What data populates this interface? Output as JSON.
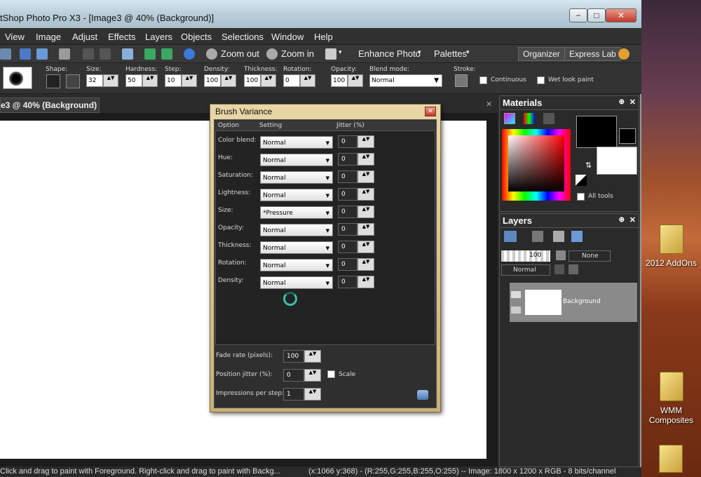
{
  "window": {
    "title": "tShop Photo Pro X3 - [Image3 @  40% (Background)]",
    "minimize": "−",
    "maximize": "□",
    "close": "✕"
  },
  "menu": [
    "View",
    "Image",
    "Adjust",
    "Effects",
    "Layers",
    "Objects",
    "Selections",
    "Window",
    "Help"
  ],
  "toolbar": {
    "zoom_out": "Zoom out",
    "zoom_in": "Zoom in",
    "enhance_photo": "Enhance Photo",
    "palettes": "Palettes",
    "organizer": "Organizer",
    "express_lab": "Express Lab",
    "arrow": "▾"
  },
  "tool_options": {
    "shape_label": "Shape:",
    "size_label": "Size:",
    "size_value": "32",
    "hardness_label": "Hardness:",
    "hardness_value": "50",
    "step_label": "Step:",
    "step_value": "10",
    "density_label": "Density:",
    "density_value": "100",
    "thickness_label": "Thickness:",
    "thickness_value": "100",
    "rotation_label": "Rotation:",
    "rotation_value": "0",
    "opacity_label": "Opacity:",
    "opacity_value": "100",
    "blend_mode_label": "Blend mode:",
    "blend_mode_value": "Normal",
    "stroke_label": "Stroke:",
    "continuous_label": "Continuous",
    "wet_look_label": "Wet look paint"
  },
  "document_tab": "e3 @  40% (Background)",
  "document_close": "✕",
  "status": {
    "hint": "Click and drag to paint with Foreground. Right-click and drag to paint with Backg...",
    "info": "(x:1066 y:368) - (R:255,G:255,B:255,O:255) -- Image: 1800 x 1200 x RGB - 8 bits/channel"
  },
  "materials": {
    "title": "Materials",
    "all_tools": "All tools"
  },
  "layers": {
    "title": "Layers",
    "opacity": "100",
    "none": "None",
    "blend": "Normal",
    "layer_name": "Background"
  },
  "dialog": {
    "title": "Brush Variance",
    "col_option": "Option",
    "col_setting": "Setting",
    "col_jitter": "Jitter (%)",
    "rows": [
      {
        "option": "Color blend:",
        "setting": "Normal",
        "jitter": "0"
      },
      {
        "option": "Hue:",
        "setting": "Normal",
        "jitter": "0"
      },
      {
        "option": "Saturation:",
        "setting": "Normal",
        "jitter": "0"
      },
      {
        "option": "Lightness:",
        "setting": "Normal",
        "jitter": "0"
      },
      {
        "option": "Size:",
        "setting": "*Pressure",
        "jitter": "0"
      },
      {
        "option": "Opacity:",
        "setting": "Normal",
        "jitter": "0"
      },
      {
        "option": "Thickness:",
        "setting": "Normal",
        "jitter": "0"
      },
      {
        "option": "Rotation:",
        "setting": "Normal",
        "jitter": "0"
      },
      {
        "option": "Density:",
        "setting": "Normal",
        "jitter": "0"
      }
    ],
    "fade_rate_label": "Fade rate (pixels):",
    "fade_rate_value": "100",
    "position_jitter_label": "Position jitter (%):",
    "position_jitter_value": "0",
    "scale_label": "Scale",
    "impressions_label": "Impressions per step:",
    "impressions_value": "1"
  },
  "desktop": {
    "icon1": "2012 AddOns",
    "icon2_line1": "WMM",
    "icon2_line2": "Composites"
  }
}
